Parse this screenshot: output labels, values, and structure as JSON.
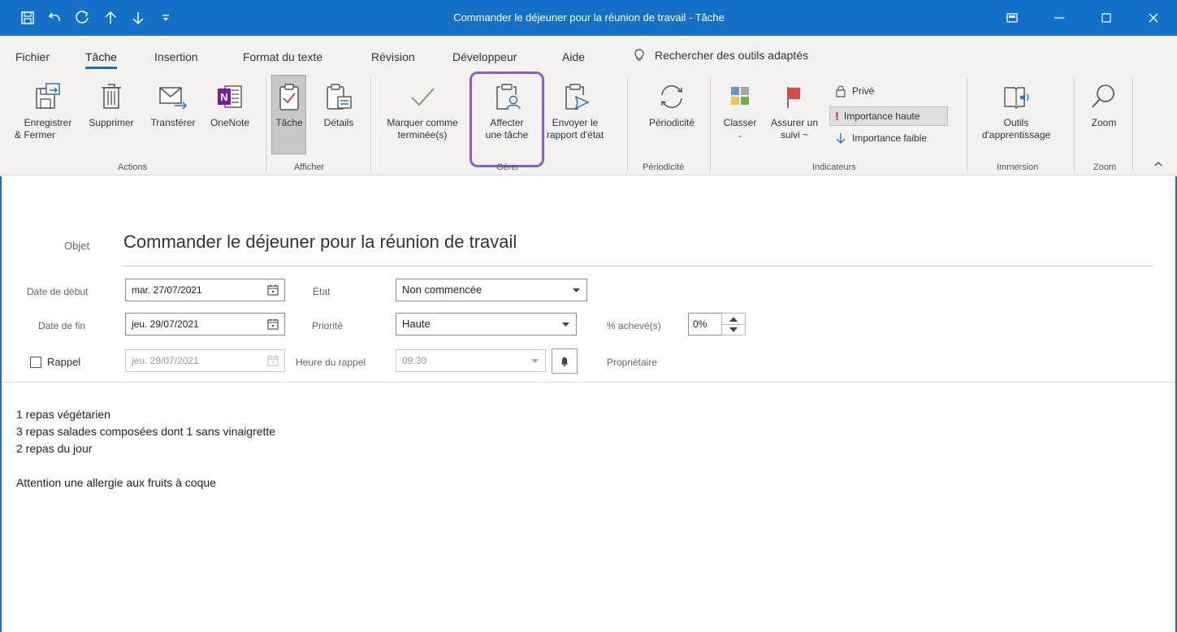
{
  "window": {
    "title": "Commander le déjeuner pour la réunion de travail  -  Tâche",
    "accent": "#1570c8"
  },
  "qat": {
    "icons": [
      "save-icon",
      "undo-icon",
      "redo-icon",
      "up-arrow-icon",
      "down-arrow-icon",
      "customize-qat-icon"
    ]
  },
  "menu": {
    "tabs": [
      "Fichier",
      "Tâche",
      "Insertion",
      "Format du texte",
      "Révision",
      "Développeur",
      "Aide"
    ],
    "active": "Tâche",
    "search": "Rechercher des outils adaptés"
  },
  "ribbon": {
    "actions": {
      "save_close": [
        "Enregistrer",
        "& Fermer"
      ],
      "delete": "Supprimer",
      "forward": "Transférer",
      "onenote": "OneNote",
      "group": "Actions"
    },
    "afficher": {
      "task": "Tâche",
      "details": "Détails",
      "group": "Afficher"
    },
    "gerer": {
      "mark_complete": [
        "Marquer comme",
        "terminée(s)"
      ],
      "assign": [
        "Affecter",
        "une tâche"
      ],
      "send_status": [
        "Envoyer le",
        "rapport d'état"
      ],
      "group": "Gérer"
    },
    "periodicite": {
      "recurrence": "Périodicité",
      "group": "Périodicité"
    },
    "indicateurs": {
      "categorize": "Classer",
      "follow_up": [
        "Assurer un",
        "suivi ~"
      ],
      "private": "Privé",
      "high_importance": "Importance haute",
      "low_importance": "Importance faible",
      "group": "Indicateurs"
    },
    "immersion": {
      "learning_tools": [
        "Outils",
        "d'apprentissage"
      ],
      "group": "Immersion"
    },
    "zoom": {
      "zoom": "Zoom",
      "group": "Zoom"
    }
  },
  "form": {
    "subject_label": "Objet",
    "subject": "Commander le déjeuner pour la réunion de travail",
    "start_label": "Date de début",
    "start_value": "mar. 27/07/2021",
    "end_label": "Date de fin",
    "end_value": "jeu. 29/07/2021",
    "reminder_label": "Rappel",
    "reminder_checked": false,
    "reminder_date": "jeu. 29/07/2021",
    "status_label": "État",
    "status_value": "Non commencée",
    "priority_label": "Priorité",
    "priority_value": "Haute",
    "reminder_time_label": "Heure du rappel",
    "reminder_time": "09:30",
    "percent_label": "% achevé(s)",
    "percent_value": "0%",
    "owner_label": "Propriétaire"
  },
  "body": {
    "lines": [
      "1 repas végétarien",
      "3 repas salades composées dont 1 sans vinaigrette",
      "2 repas du jour",
      "",
      "Attention une allergie aux fruits à coque"
    ]
  }
}
